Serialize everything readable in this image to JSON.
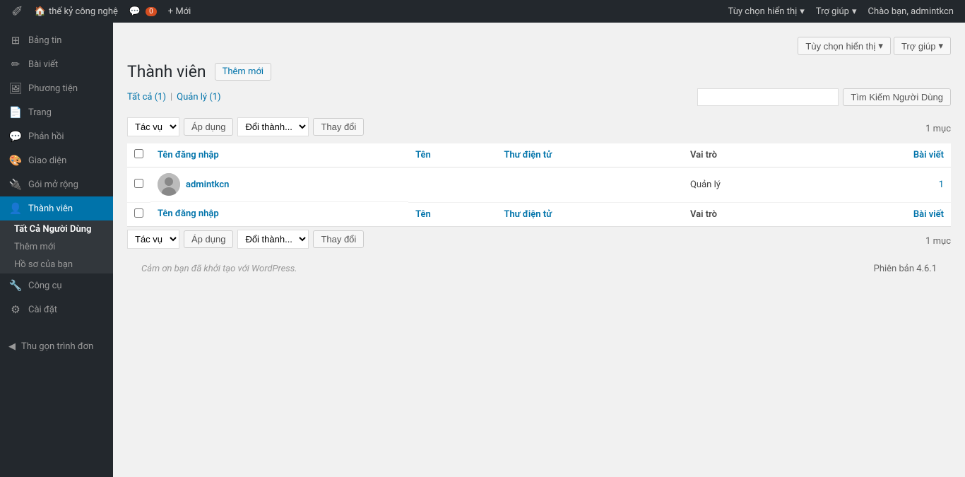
{
  "adminbar": {
    "logo": "⊞",
    "site_icon": "🏠",
    "site_name": "thế kỷ công nghệ",
    "comments_icon": "💬",
    "comments_count": "0",
    "new_label": "+ Mới",
    "greeting": "Chào bạn, admintkcn",
    "display_options_label": "Tùy chọn hiển thị",
    "help_label": "Trợ giúp"
  },
  "sidebar": {
    "items": [
      {
        "id": "bang-tin",
        "icon": "⊞",
        "label": "Bảng tin"
      },
      {
        "id": "bai-viet",
        "icon": "✏",
        "label": "Bài viết"
      },
      {
        "id": "phuong-tien",
        "icon": "🖼",
        "label": "Phương tiện"
      },
      {
        "id": "trang",
        "icon": "📄",
        "label": "Trang"
      },
      {
        "id": "phan-hoi",
        "icon": "💬",
        "label": "Phản hồi"
      },
      {
        "id": "giao-dien",
        "icon": "🎨",
        "label": "Giao diện"
      },
      {
        "id": "goi-mo-rong",
        "icon": "🔌",
        "label": "Gói mở rộng"
      },
      {
        "id": "thanh-vien",
        "icon": "👤",
        "label": "Thành viên",
        "active": true
      },
      {
        "id": "cong-cu",
        "icon": "🔧",
        "label": "Công cụ"
      },
      {
        "id": "cai-dat",
        "icon": "⚙",
        "label": "Cài đặt"
      }
    ],
    "submenu": {
      "parent": "Thành viên",
      "title": "Tất Cả Người Dùng",
      "items": [
        {
          "id": "tat-ca",
          "label": "Tất Cả Người Dùng",
          "active": true
        },
        {
          "id": "them-moi",
          "label": "Thêm mới"
        },
        {
          "id": "ho-so",
          "label": "Hồ sơ của bạn"
        }
      ]
    },
    "collapse_label": "Thu gọn trình đơn"
  },
  "page": {
    "title": "Thành viên",
    "add_new_label": "Thêm mới",
    "filter_links": [
      {
        "id": "tat-ca",
        "label": "Tất cả",
        "count": 1,
        "active": true
      },
      {
        "id": "quan-ly",
        "label": "Quản lý",
        "count": 1
      }
    ],
    "search_placeholder": "",
    "search_button_label": "Tìm Kiếm Người Dùng",
    "bulk_action_label": "Tác vụ",
    "bulk_apply_label": "Áp dụng",
    "role_change_label": "Đổi thành...",
    "role_change_button": "Thay đổi",
    "count_label": "1 mục",
    "table_headers": {
      "username": "Tên đăng nhập",
      "name": "Tên",
      "email": "Thư điện tử",
      "role": "Vai trò",
      "posts": "Bài viết"
    },
    "users": [
      {
        "id": 1,
        "username": "admintkcn",
        "name": "",
        "email": "",
        "role": "Quản lý",
        "posts": 1
      }
    ],
    "footer_credit": "Cảm ơn bạn đã khởi tạo với WordPress.",
    "footer_version": "Phiên bản 4.6.1"
  }
}
